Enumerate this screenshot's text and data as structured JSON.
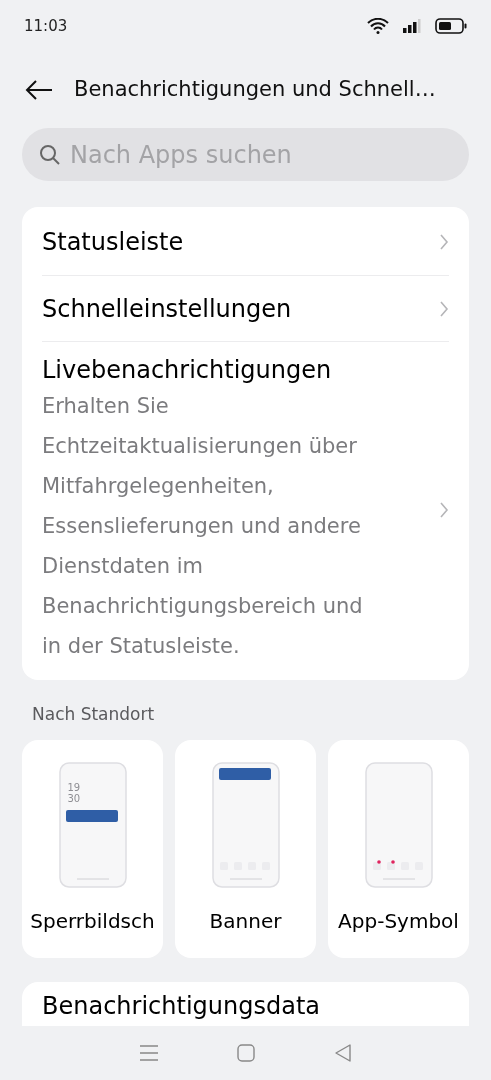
{
  "status_bar": {
    "time": "11:03"
  },
  "header": {
    "title": "Benachrichtigungen und Schnell…"
  },
  "search": {
    "placeholder": "Nach Apps suchen"
  },
  "settings": [
    {
      "title": "Statusleiste"
    },
    {
      "title": "Schnelleinstellungen"
    },
    {
      "title": "Livebenachrichtigungen",
      "description": "Erhalten Sie Echtzeitaktualisierungen über Mitfahrgelegenheiten, Essenslieferungen und andere Dienstdaten im Benachrichtigungsbereich und in der Statusleiste."
    }
  ],
  "section_label": "Nach Standort",
  "styles": [
    {
      "kind": "lockscreen",
      "label": "Sperrbildsch",
      "clock": [
        "19",
        "30"
      ]
    },
    {
      "kind": "banner",
      "label": "Banner"
    },
    {
      "kind": "icon",
      "label": "App-Symbol"
    }
  ],
  "next_card": {
    "title": "Benachrichtigungsdata"
  }
}
